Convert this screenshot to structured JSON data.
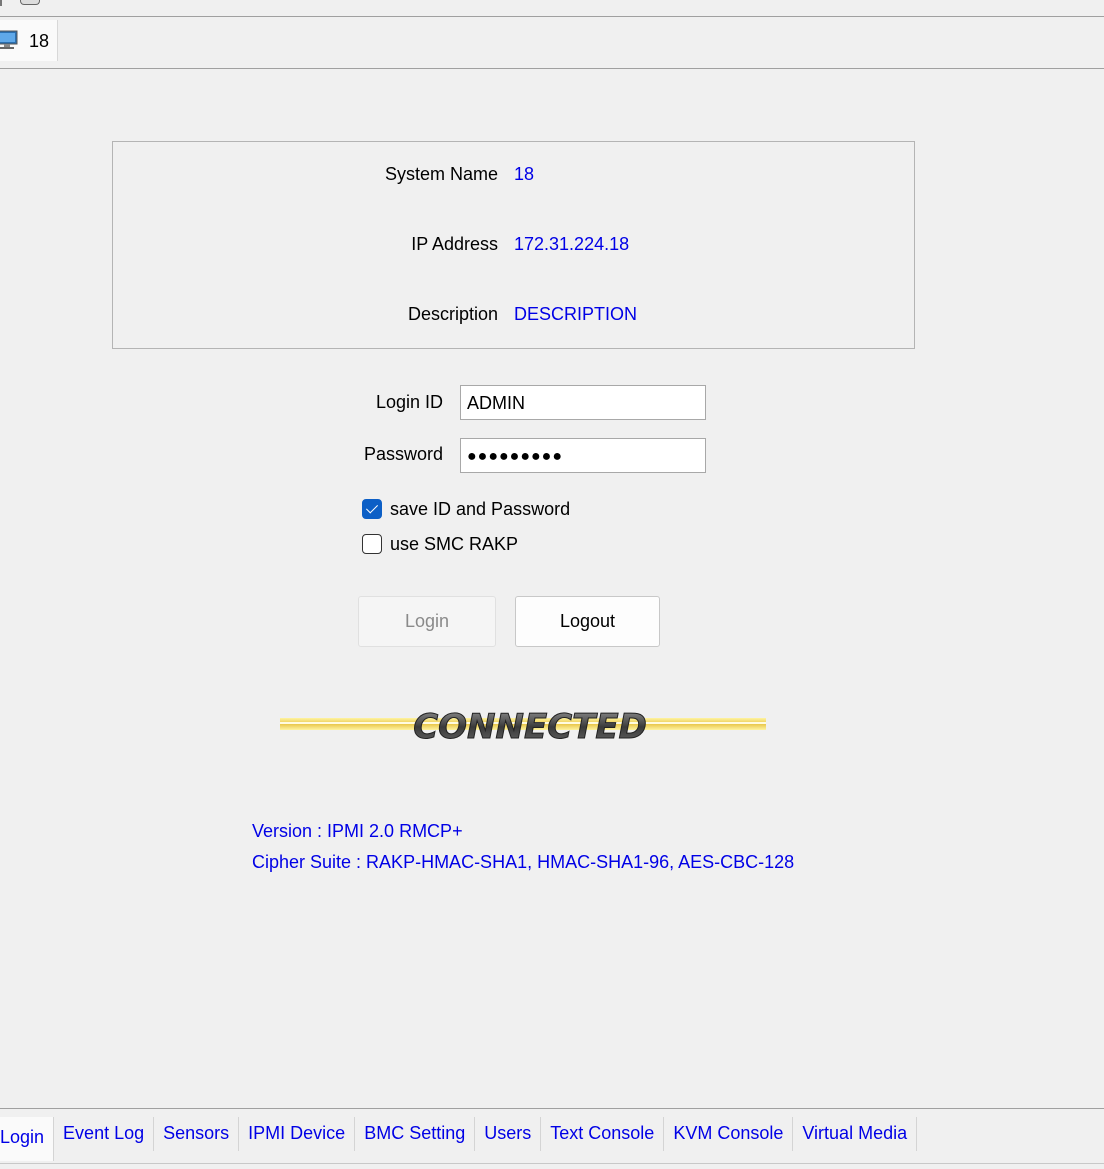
{
  "server_tab": {
    "label": "18",
    "icon": "monitor-icon"
  },
  "system_info": {
    "system_name_label": "System Name",
    "system_name": "18",
    "ip_label": "IP Address",
    "ip_address": "172.31.224.18",
    "description_label": "Description",
    "description": "DESCRIPTION"
  },
  "login_form": {
    "login_id_label": "Login ID",
    "login_id": "ADMIN",
    "password_label": "Password",
    "password_masked": "●●●●●●●●●",
    "save_label": "save ID and Password",
    "save_checked": true,
    "rakp_label": "use SMC RAKP",
    "rakp_checked": false,
    "login_button": "Login",
    "logout_button": "Logout"
  },
  "status": {
    "text": "CONNECTED"
  },
  "version_info": {
    "version": "Version : IPMI 2.0 RMCP+",
    "cipher": "Cipher Suite : RAKP-HMAC-SHA1, HMAC-SHA1-96, AES-CBC-128"
  },
  "bottom_tabs": [
    {
      "label": "Login",
      "active": true
    },
    {
      "label": "Event Log"
    },
    {
      "label": "Sensors"
    },
    {
      "label": "IPMI Device"
    },
    {
      "label": "BMC Setting"
    },
    {
      "label": "Users"
    },
    {
      "label": "Text Console"
    },
    {
      "label": "KVM Console"
    },
    {
      "label": "Virtual Media"
    }
  ],
  "colors": {
    "link": "#0000e6",
    "checkbox_on": "#0c5fc6",
    "background": "#f0f0f0"
  }
}
